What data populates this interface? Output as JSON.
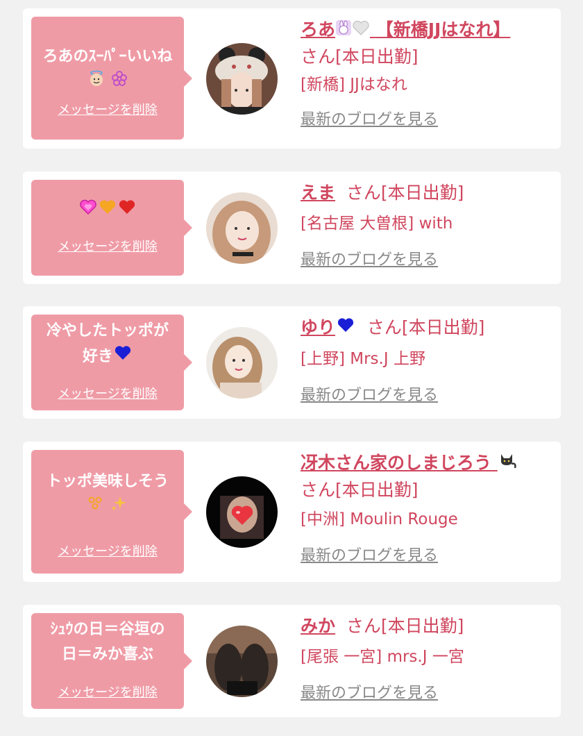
{
  "common": {
    "delete_label": "メッセージを削除",
    "blog_label": "最新のブログを見る"
  },
  "cards": [
    {
      "message": "ろあのｽｰﾊﾟｰいいね",
      "name": "ろあ",
      "name_rest": "【新橋JJはなれ】",
      "suffix": "さん[本日出勤]",
      "shop": "[新橋] JJはなれ"
    },
    {
      "message": "",
      "name": "えま",
      "suffix": "さん[本日出勤]",
      "shop": "[名古屋 大曽根] with"
    },
    {
      "message_line1": "冷やしたトッポが",
      "message_line2": "好き",
      "name": "ゆり",
      "suffix": "さん[本日出勤]",
      "shop": "[上野] Mrs.J 上野"
    },
    {
      "message": "トッポ美味しそう",
      "name": "冴木さん家のしまじろう",
      "suffix": "さん[本日出勤]",
      "shop": "[中洲] Moulin Rouge"
    },
    {
      "message_line1": "ｼｭｳの日＝谷垣の",
      "message_line2": "日＝みか喜ぶ",
      "name": "みか",
      "suffix": "さん[本日出勤]",
      "shop": "[尾張 一宮] mrs.J 一宮"
    }
  ]
}
